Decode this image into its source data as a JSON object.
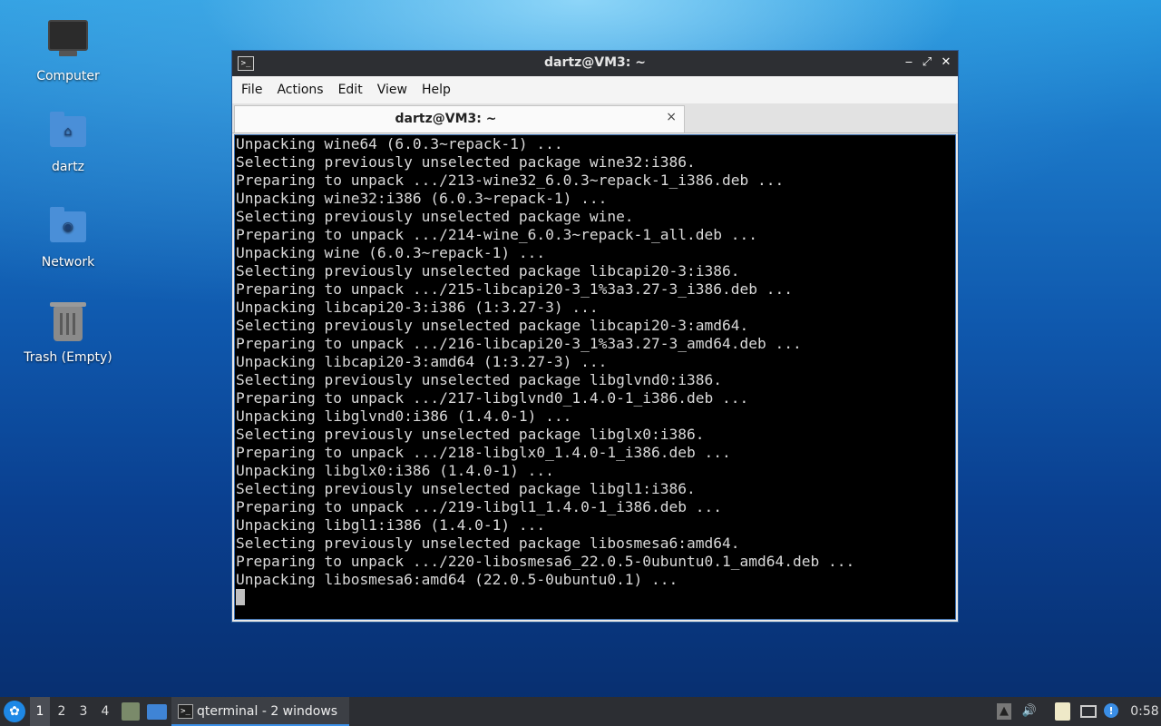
{
  "desktop": {
    "icons": [
      {
        "label": "Computer",
        "icon": "computer-icon"
      },
      {
        "label": "dartz",
        "icon": "home-folder-icon"
      },
      {
        "label": "Network",
        "icon": "network-folder-icon"
      },
      {
        "label": "Trash (Empty)",
        "icon": "trash-icon"
      }
    ]
  },
  "window": {
    "title": "dartz@VM3: ~",
    "controls": {
      "minimize": "‒",
      "maximize": "⤢",
      "close": "✕"
    },
    "menu": [
      "File",
      "Actions",
      "Edit",
      "View",
      "Help"
    ],
    "tab": {
      "label": "dartz@VM3: ~",
      "close": "×"
    },
    "terminal_lines": [
      "Unpacking wine64 (6.0.3~repack-1) ...",
      "Selecting previously unselected package wine32:i386.",
      "Preparing to unpack .../213-wine32_6.0.3~repack-1_i386.deb ...",
      "Unpacking wine32:i386 (6.0.3~repack-1) ...",
      "Selecting previously unselected package wine.",
      "Preparing to unpack .../214-wine_6.0.3~repack-1_all.deb ...",
      "Unpacking wine (6.0.3~repack-1) ...",
      "Selecting previously unselected package libcapi20-3:i386.",
      "Preparing to unpack .../215-libcapi20-3_1%3a3.27-3_i386.deb ...",
      "Unpacking libcapi20-3:i386 (1:3.27-3) ...",
      "Selecting previously unselected package libcapi20-3:amd64.",
      "Preparing to unpack .../216-libcapi20-3_1%3a3.27-3_amd64.deb ...",
      "Unpacking libcapi20-3:amd64 (1:3.27-3) ...",
      "Selecting previously unselected package libglvnd0:i386.",
      "Preparing to unpack .../217-libglvnd0_1.4.0-1_i386.deb ...",
      "Unpacking libglvnd0:i386 (1.4.0-1) ...",
      "Selecting previously unselected package libglx0:i386.",
      "Preparing to unpack .../218-libglx0_1.4.0-1_i386.deb ...",
      "Unpacking libglx0:i386 (1.4.0-1) ...",
      "Selecting previously unselected package libgl1:i386.",
      "Preparing to unpack .../219-libgl1_1.4.0-1_i386.deb ...",
      "Unpacking libgl1:i386 (1.4.0-1) ...",
      "Selecting previously unselected package libosmesa6:amd64.",
      "Preparing to unpack .../220-libosmesa6_22.0.5-0ubuntu0.1_amd64.deb ...",
      "Unpacking libosmesa6:amd64 (22.0.5-0ubuntu0.1) ..."
    ]
  },
  "taskbar": {
    "workspaces": [
      "1",
      "2",
      "3",
      "4"
    ],
    "active_workspace": "1",
    "task_label": "qterminal - 2 windows",
    "clock": "0:58",
    "accent_color": "#3a8ee6"
  }
}
